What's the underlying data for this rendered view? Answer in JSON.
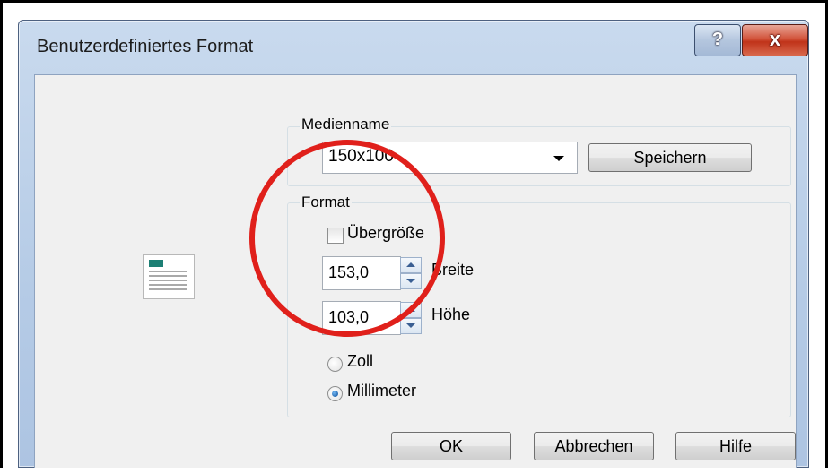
{
  "window": {
    "title": "Benutzerdefiniertes Format",
    "help_label": "?",
    "close_label": "x"
  },
  "media": {
    "group_label": "Medienname",
    "selected": "150x100",
    "save_label": "Speichern"
  },
  "format": {
    "group_label": "Format",
    "oversize_label": "Übergröße",
    "oversize_checked": false,
    "width_value": "153,0",
    "width_label": "Breite",
    "height_value": "103,0",
    "height_label": "Höhe",
    "units": [
      {
        "label": "Zoll",
        "selected": false
      },
      {
        "label": "Millimeter",
        "selected": true
      }
    ]
  },
  "buttons": {
    "ok_label": "OK",
    "cancel_label": "Abbrechen",
    "help_label": "Hilfe"
  },
  "annotation": {
    "highlight_color": "#e0201b"
  }
}
